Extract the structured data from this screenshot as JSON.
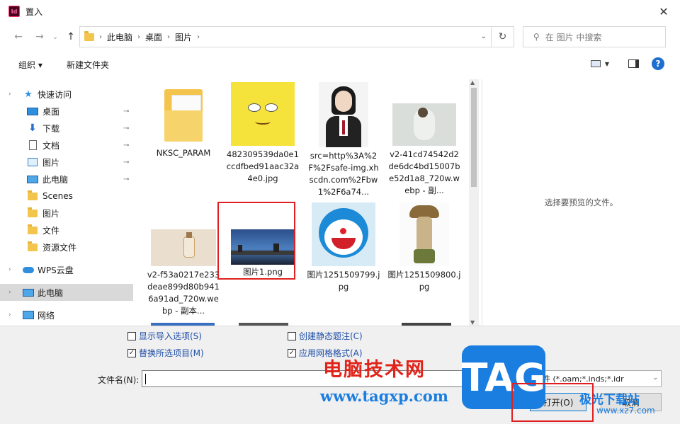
{
  "window": {
    "title": "置入",
    "app_icon_text": "Id",
    "close_glyph": "✕"
  },
  "nav": {
    "back_glyph": "←",
    "forward_glyph": "→",
    "recent_glyph": "⌄",
    "up_glyph": "↑",
    "breadcrumbs": [
      "此电脑",
      "桌面",
      "图片"
    ],
    "refresh_glyph": "↻",
    "search_placeholder": "在 图片 中搜索"
  },
  "toolbar": {
    "organize": "组织 ▾",
    "new_folder": "新建文件夹",
    "help": "?"
  },
  "sidebar": {
    "items": [
      {
        "label": "快速访问",
        "icon": "star-icon",
        "pinned": false
      },
      {
        "label": "桌面",
        "icon": "desktop-icon",
        "pinned": true
      },
      {
        "label": "下载",
        "icon": "download-icon",
        "pinned": true
      },
      {
        "label": "文档",
        "icon": "document-icon",
        "pinned": true
      },
      {
        "label": "图片",
        "icon": "pictures-icon",
        "pinned": true
      },
      {
        "label": "此电脑",
        "icon": "computer-icon",
        "pinned": true
      },
      {
        "label": "Scenes",
        "icon": "folder-icon",
        "pinned": false
      },
      {
        "label": "图片",
        "icon": "folder-icon",
        "pinned": false
      },
      {
        "label": "文件",
        "icon": "folder-icon",
        "pinned": false
      },
      {
        "label": "资源文件",
        "icon": "folder-icon",
        "pinned": false
      },
      {
        "label": "WPS云盘",
        "icon": "cloud-icon",
        "pinned": false
      },
      {
        "label": "此电脑",
        "icon": "computer-icon",
        "pinned": false,
        "selected": true
      },
      {
        "label": "网络",
        "icon": "network-icon",
        "pinned": false
      }
    ],
    "pin_glyph": "📌"
  },
  "files": [
    {
      "name": "NKSC_PARAM",
      "kind": "folder"
    },
    {
      "name": "482309539da0e1ccdfbed91aac32a4e0.jpg",
      "kind": "image-yellow"
    },
    {
      "name": "src=http%3A%2F%2Fsafe-img.xhscdn.com%2Fbw1%2F6a74...",
      "kind": "image-portrait"
    },
    {
      "name": "v2-41cd74542d2de6dc4bd15007be52d1a8_720w.webp - 副...",
      "kind": "image-gray"
    },
    {
      "name": "v2-f53a0217e233deae899d80b9416a91ad_720w.webp - 副本...",
      "kind": "image-bottle"
    },
    {
      "name": "图片1.png",
      "kind": "image-city"
    },
    {
      "name": "图片1251509799.jpg",
      "kind": "image-doraemon"
    },
    {
      "name": "图片1251509800.jpg",
      "kind": "image-figure"
    }
  ],
  "preview_text": "选择要预览的文件。",
  "options": {
    "show_import": "显示导入选项(S)",
    "replace_selected": "替换所选项目(M)",
    "create_caption": "创建静态题注(C)",
    "apply_grid": "应用网格格式(A)"
  },
  "filename": {
    "label": "文件名(N):",
    "value": ""
  },
  "filetype": {
    "value": "文件 (*.oam;*.inds;*.idr"
  },
  "buttons": {
    "open": "打开(O)",
    "cancel": "取消"
  },
  "watermark": {
    "brand_cn": "电脑技术网",
    "url": "www.tagxp.com",
    "tag": "TAG",
    "site": "极光下载站",
    "site2": "www.xz7.com"
  },
  "colors": {
    "accent": "#0078d7",
    "selection": "#d9d9d9",
    "highlight_box": "#e02020"
  }
}
